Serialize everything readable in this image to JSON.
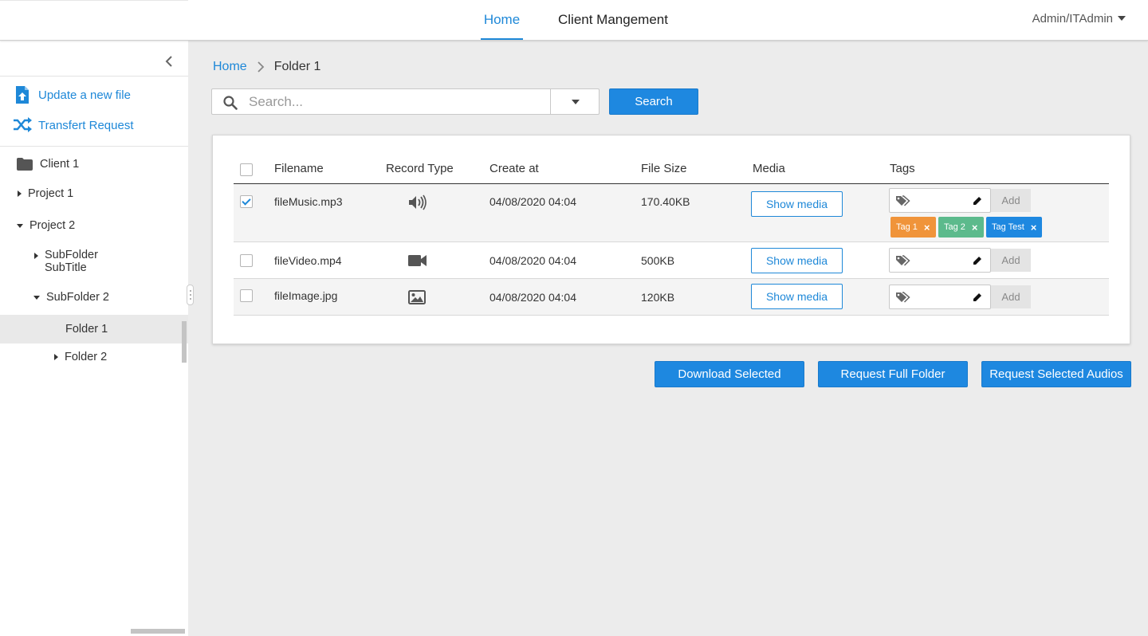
{
  "header": {
    "nav": [
      {
        "label": "Home",
        "active": true
      },
      {
        "label": "Client Mangement",
        "active": false
      }
    ],
    "user": "Admin/ITAdmin",
    "accent_color": "#1e88d8"
  },
  "sidebar": {
    "actions": [
      {
        "label": "Update a new file",
        "icon": "file-upload-icon"
      },
      {
        "label": "Transfert Request",
        "icon": "shuffle-icon"
      }
    ],
    "tree": {
      "client": "Client 1",
      "project1": "Project 1",
      "project2": "Project 2",
      "subfolder_title": "SubFolder",
      "subfolder_subtitle": "SubTitle",
      "subfolder2": "SubFolder 2",
      "folder1": "Folder 1",
      "folder2": "Folder 2",
      "selected": "Folder 1"
    }
  },
  "breadcrumb": {
    "home": "Home",
    "current": "Folder 1"
  },
  "search": {
    "placeholder": "Search...",
    "value": "",
    "button": "Search"
  },
  "table": {
    "headers": {
      "filename": "Filename",
      "record_type": "Record Type",
      "created": "Create at",
      "size": "File Size",
      "media": "Media",
      "tags": "Tags"
    },
    "rows": [
      {
        "checked": true,
        "filename": "fileMusic.mp3",
        "type_icon": "speaker-icon",
        "created": "04/08/2020 04:04",
        "size": "170.40KB",
        "media_button": "Show media",
        "tag_add": "Add",
        "tags": [
          "Tag 1",
          "Tag 2",
          "Tag Test"
        ]
      },
      {
        "checked": false,
        "filename": "fileVideo.mp4",
        "type_icon": "video-camera-icon",
        "created": "04/08/2020 04:04",
        "size": "500KB",
        "media_button": "Show media",
        "tag_add": "Add",
        "tags": []
      },
      {
        "checked": false,
        "filename": "fileImage.jpg",
        "type_icon": "image-icon",
        "created": "04/08/2020 04:04",
        "size": "120KB",
        "media_button": "Show media",
        "tag_add": "Add",
        "tags": []
      }
    ],
    "tag_colors": [
      "#f0943a",
      "#5cba8c",
      "#1e88e0"
    ]
  },
  "actions": {
    "download": "Download Selected",
    "request_folder": "Request Full Folder",
    "request_audios": "Request Selected Audios"
  }
}
